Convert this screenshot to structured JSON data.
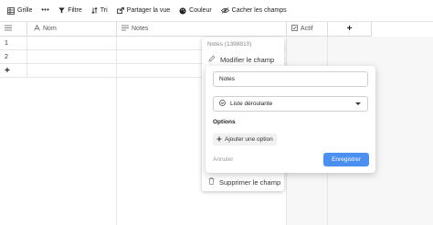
{
  "toolbar": {
    "grid": "Grille",
    "more": "•••",
    "filter": "Filtre",
    "sort": "Tri",
    "share": "Partager la vue",
    "color": "Couleur",
    "hide": "Cacher les champs"
  },
  "table": {
    "columns": {
      "name": "Nom",
      "notes": "Notes",
      "active": "Actif",
      "add": "+"
    },
    "rows": [
      "1",
      "2"
    ],
    "add_row": "+"
  },
  "field_menu": {
    "title": "Notes (1398810)",
    "edit": "Modifier le champ",
    "delete": "Supprimer le champ"
  },
  "edit_panel": {
    "name_value": "Notes",
    "type_value": "Liste déroulante",
    "options_label": "Options",
    "add_option": "Ajouter une option",
    "cancel": "Annuler",
    "save": "Enregistrer",
    "accent_color": "#4b8ff0"
  }
}
